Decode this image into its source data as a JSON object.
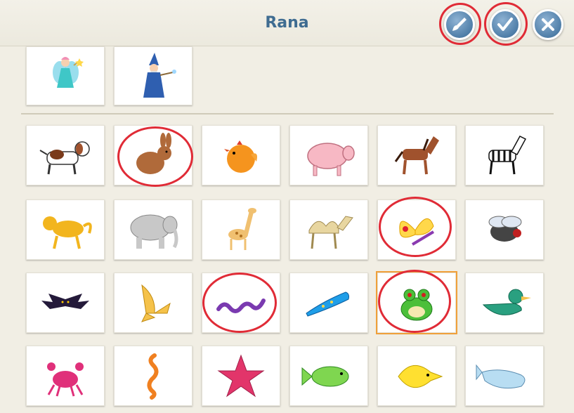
{
  "header": {
    "title": "Rana",
    "buttons": [
      {
        "name": "paint-button",
        "icon": "paintbrush-icon"
      },
      {
        "name": "confirm-button",
        "icon": "checkmark-icon"
      },
      {
        "name": "close-button",
        "icon": "close-icon"
      }
    ]
  },
  "characters": [
    "fairy",
    "wizard"
  ],
  "animals": [
    "dog",
    "rabbit",
    "chick",
    "pig",
    "horse",
    "zebra",
    "monkey",
    "elephant",
    "giraffe",
    "camel",
    "butterfly",
    "fly",
    "bat",
    "bird",
    "snake",
    "lizard",
    "frog",
    "duck",
    "crab",
    "seahorse",
    "starfish",
    "fish",
    "yellow-fish",
    "whale"
  ],
  "selected": "frog",
  "highlighted": [
    "paint-button",
    "confirm-button",
    "rabbit",
    "butterfly",
    "snake",
    "frog"
  ],
  "colors": {
    "accent": "#3f6c91",
    "highlight": "#e02b36",
    "selection": "#f0a03a"
  }
}
